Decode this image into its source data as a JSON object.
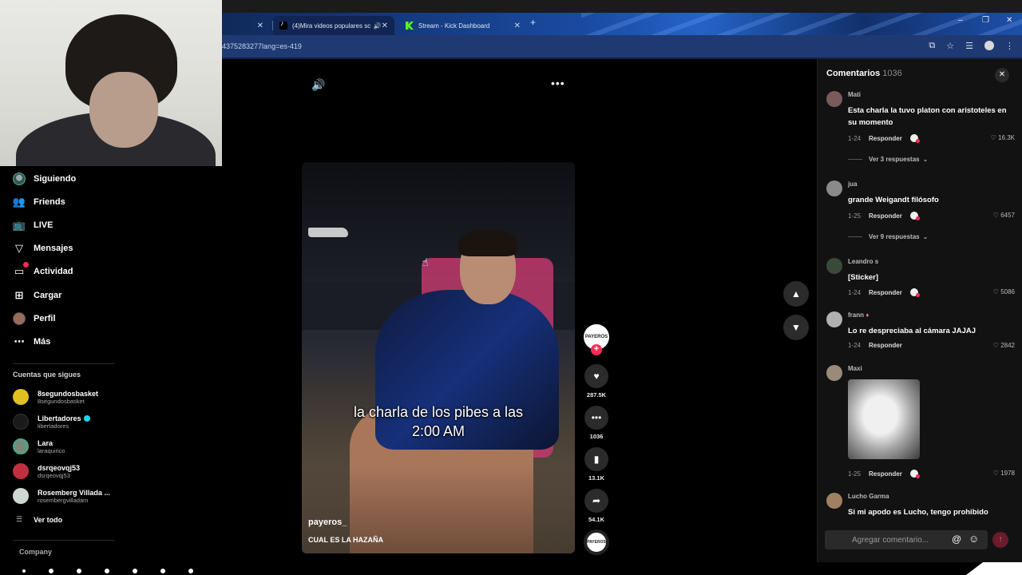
{
  "browser": {
    "tabs": [
      {
        "label": "",
        "active": false
      },
      {
        "label": "(4)Mira videos populares sc",
        "active": true
      },
      {
        "label": "Stream - Kick Dashboard",
        "active": false
      }
    ],
    "new_tab": "+",
    "url": "4375283277lang=es-419",
    "window_controls": {
      "minimize": "–",
      "restore": "❐",
      "close": "✕"
    },
    "icons": [
      "translate-icon",
      "star-icon",
      "reading-list-icon",
      "profile-icon",
      "menu-icon"
    ]
  },
  "sidebar": {
    "items": [
      {
        "label": "Siguiendo",
        "icon": "following-avatar-icon"
      },
      {
        "label": "Friends",
        "icon": "friends-icon"
      },
      {
        "label": "LIVE",
        "icon": "live-icon"
      },
      {
        "label": "Mensajes",
        "icon": "messages-icon"
      },
      {
        "label": "Actividad",
        "icon": "activity-icon"
      },
      {
        "label": "Cargar",
        "icon": "upload-icon"
      },
      {
        "label": "Perfil",
        "icon": "profile-icon"
      },
      {
        "label": "Más",
        "icon": "more-icon"
      }
    ],
    "following_title": "Cuentas que sigues",
    "following": [
      {
        "name": "8segundosbasket",
        "handle": "8segundosbasket",
        "verified": false,
        "color": "#e0c020"
      },
      {
        "name": "Libertadores",
        "handle": "libertadores",
        "verified": true,
        "color": "#1a1a1a"
      },
      {
        "name": "Lara",
        "handle": "laraquirico",
        "verified": false,
        "color": "#7a8a7a"
      },
      {
        "name": "dsrqeovqj53",
        "handle": "dsrqeovqj53",
        "verified": false,
        "color": "#c03040"
      },
      {
        "name": "Rosemberg Villada ...",
        "handle": "rosembergvilladam",
        "verified": false,
        "color": "#cfd8d0"
      }
    ],
    "see_all": "Ver todo",
    "company": "Company"
  },
  "video": {
    "caption_line1": "la charla de los pibes a las",
    "caption_line2": "2:00 AM",
    "author": "payeros_",
    "description": "CUAL ES LA HAZAÑA",
    "creator_avatar_text": "PAYEROS",
    "actions": {
      "likes": "287.5K",
      "comments": "1036",
      "saves": "13.1K",
      "shares": "54.1K"
    }
  },
  "comments": {
    "title": "Comentarios",
    "count": "1036",
    "items": [
      {
        "user": "Mati",
        "text": "Esta charla la tuvo platon con aristoteles en su momento",
        "date": "1-24",
        "reply": "Responder",
        "likes": "16.3K",
        "replies": "Ver 3 respuestas",
        "avatar_color": "#7a5a5a"
      },
      {
        "user": "jua",
        "text": "grande Weigandt filósofo",
        "date": "1-25",
        "reply": "Responder",
        "likes": "6457",
        "replies": "Ver 9 respuestas",
        "avatar_color": "#8a8a8a"
      },
      {
        "user": "Leandro s",
        "text": "[Sticker]",
        "date": "1-24",
        "reply": "Responder",
        "likes": "5086",
        "avatar_color": "#3a4a3a"
      },
      {
        "user": "frann",
        "text": "Lo re despreciaba al cámara JAJAJ",
        "date": "1-24",
        "reply": "Responder",
        "likes": "2842",
        "avatar_color": "#b0b0b0"
      },
      {
        "user": "Maxi",
        "text": "",
        "date": "1-25",
        "reply": "Responder",
        "likes": "1978",
        "avatar_color": "#9a8a7a"
      },
      {
        "user": "Lucho Garma",
        "text": "Si mi apodo es Lucho, tengo prohibido",
        "avatar_color": "#a08060"
      }
    ],
    "input_placeholder": "Agregar comentario...",
    "at_symbol": "@"
  }
}
